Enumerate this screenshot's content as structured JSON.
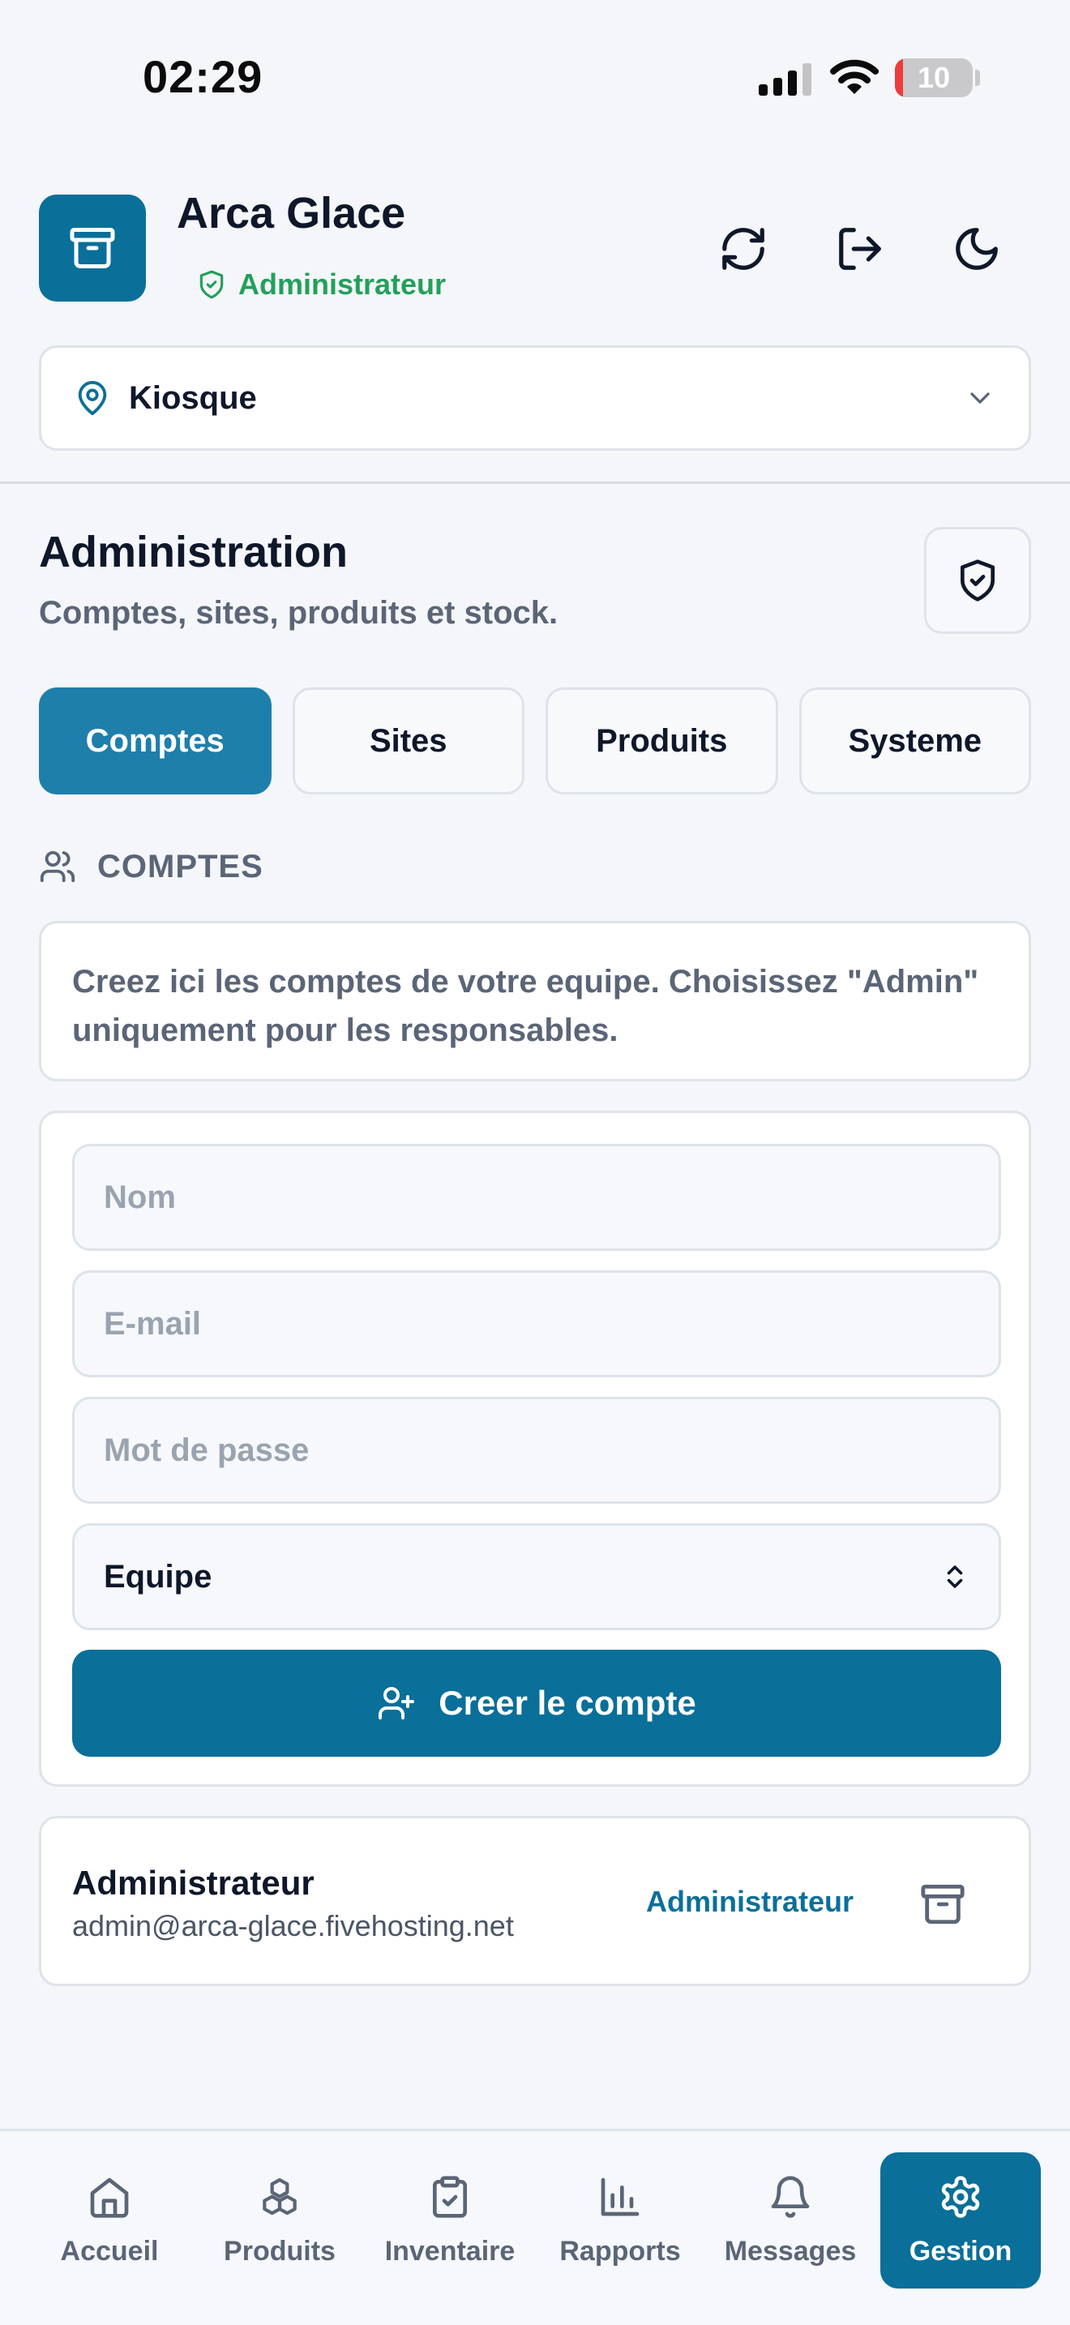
{
  "status_bar": {
    "time": "02:29",
    "battery": "10",
    "battery_level": 0.1
  },
  "header": {
    "app_title": "Arca Glace",
    "role": "Administrateur",
    "actions": [
      "refresh-icon",
      "logout-icon",
      "moon-icon"
    ]
  },
  "site_selector": {
    "value": "Kiosque"
  },
  "admin": {
    "title": "Administration",
    "subtitle": "Comptes, sites, produits et stock."
  },
  "tabs": [
    {
      "label": "Comptes",
      "active": true
    },
    {
      "label": "Sites",
      "active": false
    },
    {
      "label": "Produits",
      "active": false
    },
    {
      "label": "Systeme",
      "active": false
    }
  ],
  "comptes": {
    "heading": "COMPTES",
    "info": "Creez ici les comptes de votre equipe. Choisissez \"Admin\" uniquement pour les responsables.",
    "form": {
      "name_placeholder": "Nom",
      "email_placeholder": "E-mail",
      "password_placeholder": "Mot de passe",
      "role_value": "Equipe",
      "submit_label": "Creer le compte"
    },
    "accounts": [
      {
        "name": "Administrateur",
        "email": "admin@arca-glace.fivehosting.net",
        "role": "Administrateur"
      }
    ]
  },
  "bottom_nav": [
    {
      "label": "Accueil",
      "icon": "home-icon",
      "active": false
    },
    {
      "label": "Produits",
      "icon": "boxes-icon",
      "active": false
    },
    {
      "label": "Inventaire",
      "icon": "clipboard-check-icon",
      "active": false
    },
    {
      "label": "Rapports",
      "icon": "bar-chart-icon",
      "active": false
    },
    {
      "label": "Messages",
      "icon": "bell-icon",
      "active": false
    },
    {
      "label": "Gestion",
      "icon": "gear-icon",
      "active": true
    }
  ],
  "colors": {
    "primary": "#0a6f99",
    "tab_active": "#1e7fab",
    "success": "#23a05a",
    "muted_text": "#5b6577",
    "border": "#dde3ea"
  }
}
